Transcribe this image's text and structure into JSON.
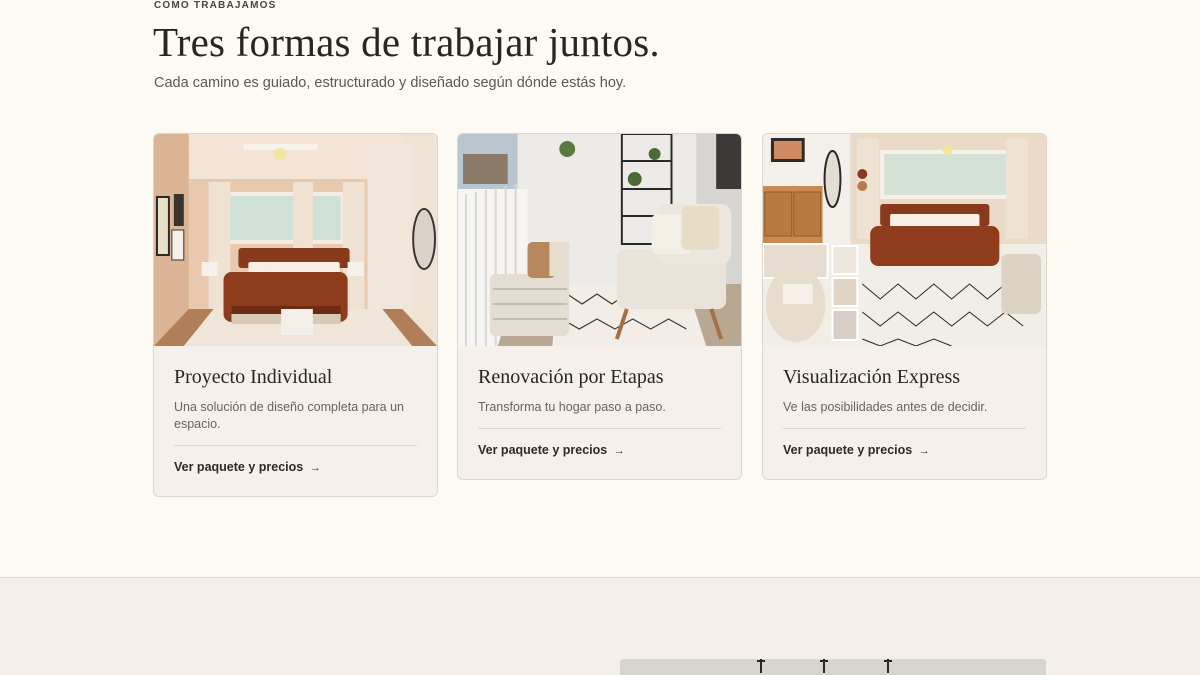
{
  "section": {
    "eyebrow": "CÓMO TRABAJAMOS",
    "title": "Tres formas de trabajar juntos.",
    "subtitle": "Cada camino es guiado, estructurado y diseñado según dónde estás hoy."
  },
  "cards": [
    {
      "image_icon": "bedroom-photo",
      "title": "Proyecto Individual",
      "description": "Una solución de diseño completa para un espacio.",
      "link_label": "Ver paquete y precios",
      "link_arrow": "→"
    },
    {
      "image_icon": "balcony-photo",
      "title": "Renovación por Etapas",
      "description": "Transforma tu hogar paso a paso.",
      "link_label": "Ver paquete y precios",
      "link_arrow": "→"
    },
    {
      "image_icon": "moodboard-photo",
      "title": "Visualización Express",
      "description": "Ve las posibilidades antes de decidir.",
      "link_label": "Ver paquete y precios",
      "link_arrow": "→"
    }
  ],
  "colors": {
    "background": "#fdf9f3",
    "card_background": "#f5f1ea",
    "band_background": "#f4efe8",
    "text_dark": "#2a2520",
    "text_muted": "#6b635b",
    "accent_rust": "#8a3a1c"
  }
}
